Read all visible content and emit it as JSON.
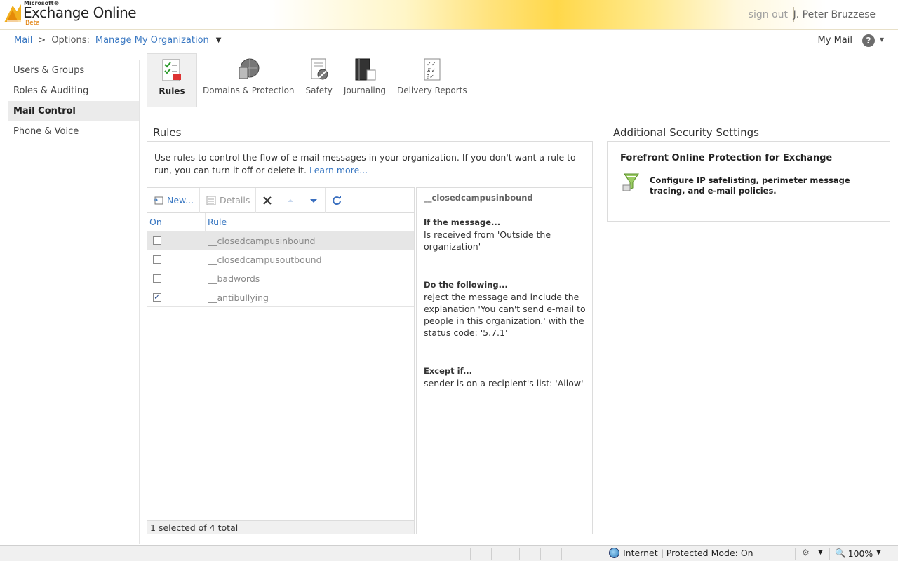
{
  "header": {
    "brand_ms": "Microsoft®",
    "brand_title": "Exchange Online",
    "brand_beta": "Beta",
    "sign_out": "sign out",
    "user_name": "J. Peter Bruzzese"
  },
  "breadcrumb": {
    "mail": "Mail",
    "sep": ">",
    "options_label": "Options:",
    "current": "Manage My Organization",
    "dropdown": "▼"
  },
  "topright": {
    "my_mail": "My Mail",
    "help": "?",
    "help_dropdown": "▼"
  },
  "sidebar": {
    "items": [
      {
        "label": "Users & Groups"
      },
      {
        "label": "Roles & Auditing"
      },
      {
        "label": "Mail Control"
      },
      {
        "label": "Phone & Voice"
      }
    ]
  },
  "tabs": [
    {
      "label": "Rules",
      "icon": "rules-icon"
    },
    {
      "label": "Domains & Protection",
      "icon": "domains-icon"
    },
    {
      "label": "Safety",
      "icon": "safety-icon"
    },
    {
      "label": "Journaling",
      "icon": "journaling-icon"
    },
    {
      "label": "Delivery Reports",
      "icon": "delivery-reports-icon"
    }
  ],
  "rules": {
    "title": "Rules",
    "description": "Use rules to control the flow of e-mail messages in your organization. If you don't want a rule to run, you can turn it off or delete it.",
    "learn_more": "Learn more...",
    "toolbar": {
      "new": "New...",
      "details": "Details"
    },
    "columns": {
      "on": "On",
      "rule": "Rule"
    },
    "rows": [
      {
        "name": "__closedcampusinbound",
        "on": false
      },
      {
        "name": "__closedcampusoutbound",
        "on": false
      },
      {
        "name": "__badwords",
        "on": false
      },
      {
        "name": "__antibullying",
        "on": true
      }
    ],
    "status": "1 selected of 4 total",
    "detail": {
      "name": "__closedcampusinbound",
      "if_head": "If the message...",
      "if_text": "Is received from 'Outside the organization'",
      "do_head": "Do the following...",
      "do_text": "reject the message and include the explanation 'You can't send e-mail to people in this organization.' with the status code: '5.7.1'",
      "except_head": "Except if...",
      "except_text": "sender is on a recipient's list: 'Allow'"
    }
  },
  "security": {
    "title": "Additional Security Settings",
    "fope_title": "Forefront Online Protection for Exchange",
    "fope_text": "Configure IP safelisting, perimeter message tracing, and e-mail policies."
  },
  "statusbar": {
    "zone": "Internet | Protected Mode: On",
    "zoom": "100%"
  }
}
